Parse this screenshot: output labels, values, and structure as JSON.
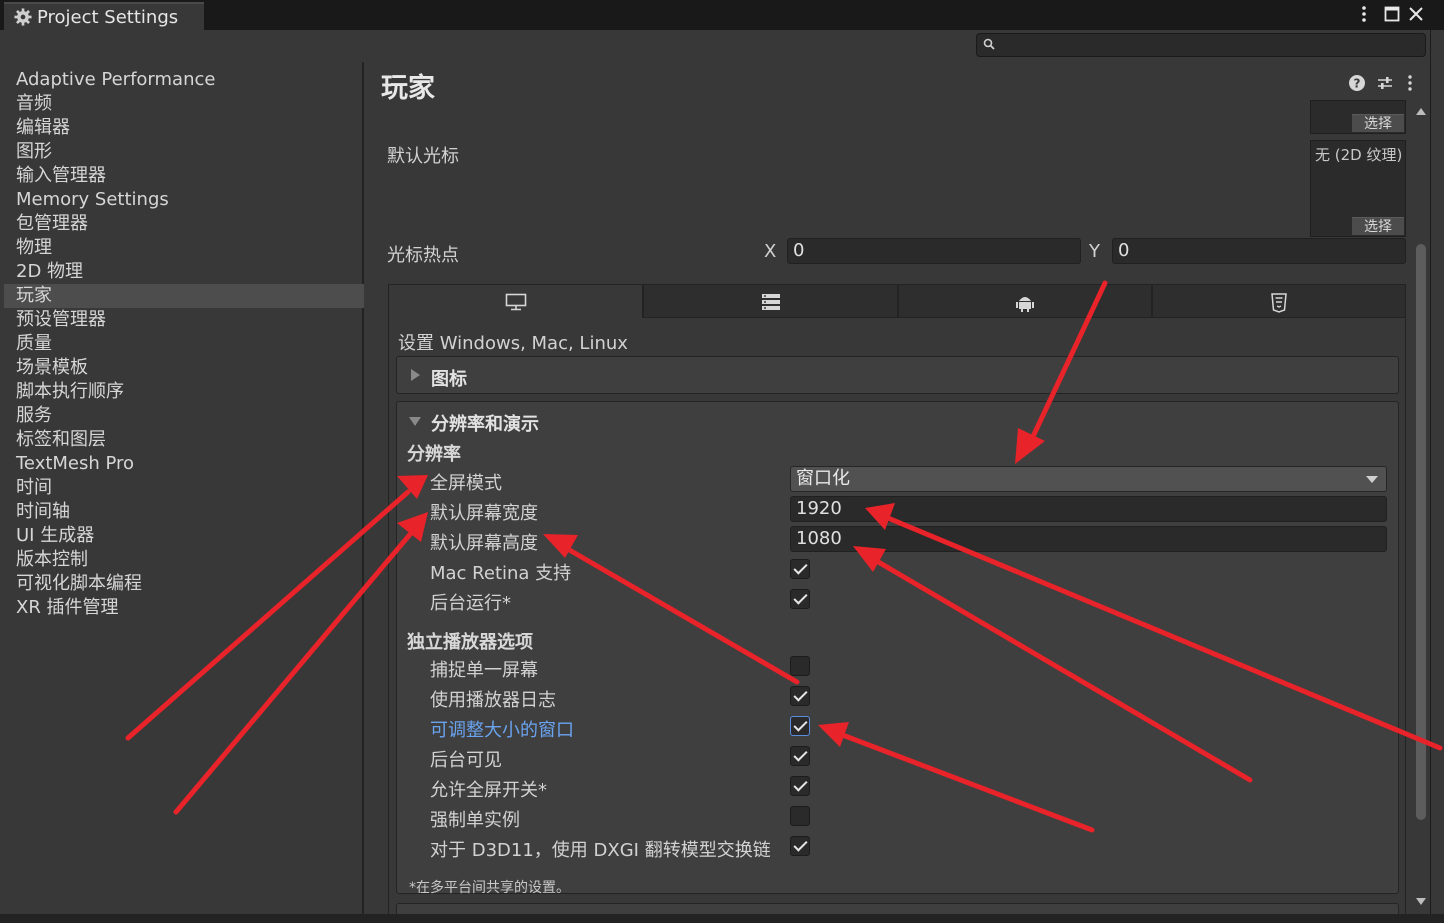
{
  "window": {
    "tab_title": "Project Settings",
    "menu_icon": "kebab-menu-icon",
    "maximize_icon": "maximize-icon",
    "close_icon": "close-icon"
  },
  "search": {
    "value": "",
    "placeholder": ""
  },
  "sidebar": {
    "items": [
      {
        "label": "Adaptive Performance"
      },
      {
        "label": "音频"
      },
      {
        "label": "编辑器"
      },
      {
        "label": "图形"
      },
      {
        "label": "输入管理器"
      },
      {
        "label": "Memory Settings"
      },
      {
        "label": "包管理器"
      },
      {
        "label": "物理"
      },
      {
        "label": "2D 物理"
      },
      {
        "label": "玩家",
        "selected": true
      },
      {
        "label": "预设管理器"
      },
      {
        "label": "质量"
      },
      {
        "label": "场景模板"
      },
      {
        "label": "脚本执行顺序"
      },
      {
        "label": "服务"
      },
      {
        "label": "标签和图层"
      },
      {
        "label": "TextMesh Pro"
      },
      {
        "label": "时间"
      },
      {
        "label": "时间轴"
      },
      {
        "label": "UI 生成器"
      },
      {
        "label": "版本控制"
      },
      {
        "label": "可视化脚本编程"
      },
      {
        "label": "XR 插件管理"
      }
    ]
  },
  "main": {
    "title": "玩家",
    "select_label": "选择",
    "cursor": {
      "label": "默认光标",
      "value": "无 (2D 纹理)",
      "select_label": "选择"
    },
    "hotspot": {
      "label": "光标热点",
      "x_label": "X",
      "x_value": "0",
      "y_label": "Y",
      "y_value": "0"
    },
    "platform_tabs": [
      {
        "icon": "monitor-icon",
        "active": true
      },
      {
        "icon": "server-icon"
      },
      {
        "icon": "android-icon"
      },
      {
        "icon": "html5-icon"
      }
    ],
    "platform_header": "设置 Windows, Mac, Linux",
    "icon_section": "图标",
    "resolution_section": {
      "title": "分辨率和演示",
      "sub_resolution": "分辨率",
      "fullscreen_mode": {
        "label": "全屏模式",
        "value": "窗口化"
      },
      "default_width": {
        "label": "默认屏幕宽度",
        "value": "1920"
      },
      "default_height": {
        "label": "默认屏幕高度",
        "value": "1080"
      },
      "mac_retina": {
        "label": "Mac Retina 支持",
        "checked": true
      },
      "run_background": {
        "label": "后台运行*",
        "checked": true
      },
      "standalone_header": "独立播放器选项",
      "standalone": [
        {
          "label": "捕捉单一屏幕",
          "checked": false
        },
        {
          "label": "使用播放器日志",
          "checked": true
        },
        {
          "label": "可调整大小的窗口",
          "checked": true,
          "highlight": true
        },
        {
          "label": "后台可见",
          "checked": true
        },
        {
          "label": "允许全屏开关*",
          "checked": true
        },
        {
          "label": "强制单实例",
          "checked": false
        },
        {
          "label": "对于 D3D11，使用 DXGI 翻转模型交换链",
          "checked": true
        }
      ],
      "shared_note": "*在多平台间共享的设置。"
    }
  },
  "colors": {
    "background": "#383838",
    "titlebar": "#191919",
    "selected_item": "#4d4d4d",
    "highlight_label": "#6aa3f0",
    "annotation_arrow": "#e8232a"
  }
}
